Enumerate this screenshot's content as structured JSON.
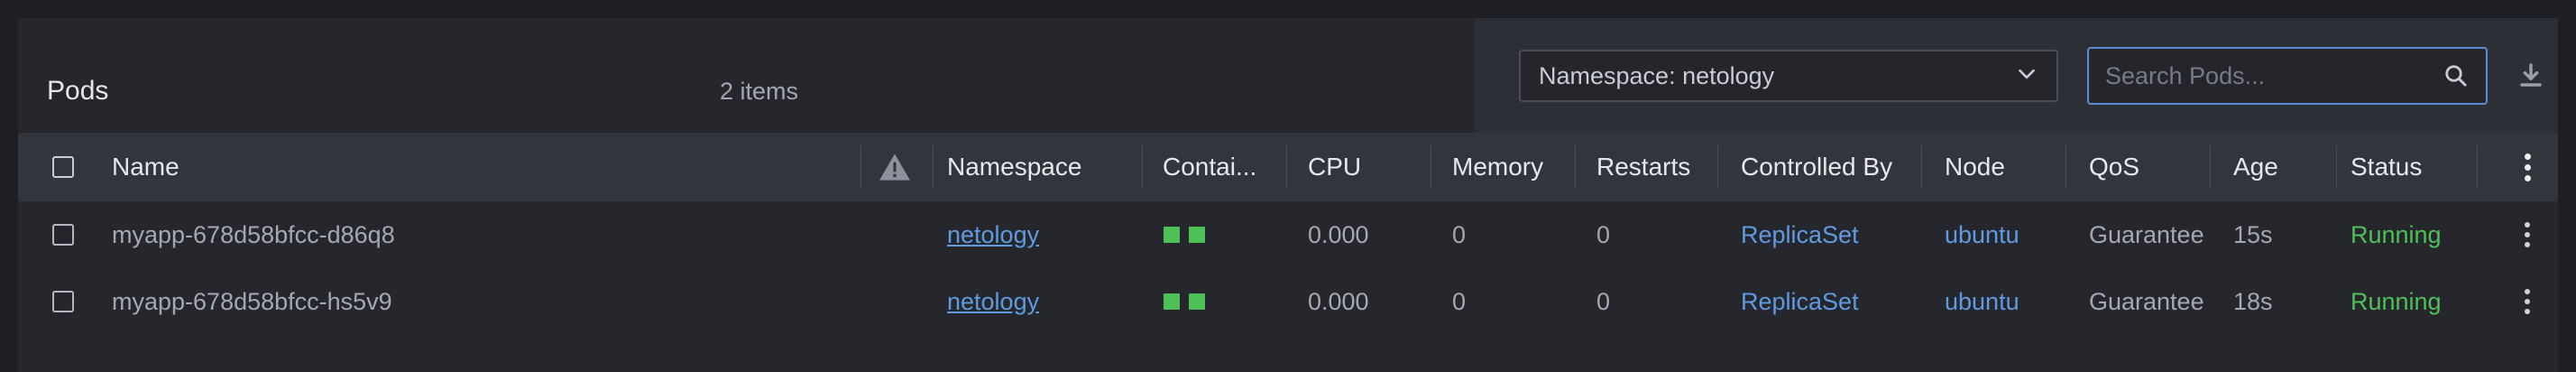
{
  "header": {
    "title": "Pods",
    "item_count": "2 items"
  },
  "filters": {
    "namespace_label": "Namespace: netology",
    "search_placeholder": "Search Pods...",
    "search_value": ""
  },
  "icons": {
    "chevron": "chevron-down-icon",
    "search": "search-icon",
    "download": "download-icon",
    "warning": "warning-icon",
    "menu": "kebab-menu-icon"
  },
  "colors": {
    "accent": "#5e9be0",
    "running": "#4fbf57",
    "container_ready": "#4fbf57"
  },
  "table": {
    "columns": {
      "name": "Name",
      "namespace": "Namespace",
      "containers": "Contai...",
      "cpu": "CPU",
      "memory": "Memory",
      "restarts": "Restarts",
      "controlled_by": "Controlled By",
      "node": "Node",
      "qos": "QoS",
      "age": "Age",
      "status": "Status"
    },
    "rows": [
      {
        "name": "myapp-678d58bfcc-d86q8",
        "namespace": "netology",
        "containers": 2,
        "cpu": "0.000",
        "memory": "0",
        "restarts": "0",
        "controlled_by": "ReplicaSet",
        "node": "ubuntu",
        "qos": "Guarantee",
        "age": "15s",
        "status": "Running"
      },
      {
        "name": "myapp-678d58bfcc-hs5v9",
        "namespace": "netology",
        "containers": 2,
        "cpu": "0.000",
        "memory": "0",
        "restarts": "0",
        "controlled_by": "ReplicaSet",
        "node": "ubuntu",
        "qos": "Guarantee",
        "age": "18s",
        "status": "Running"
      }
    ]
  }
}
